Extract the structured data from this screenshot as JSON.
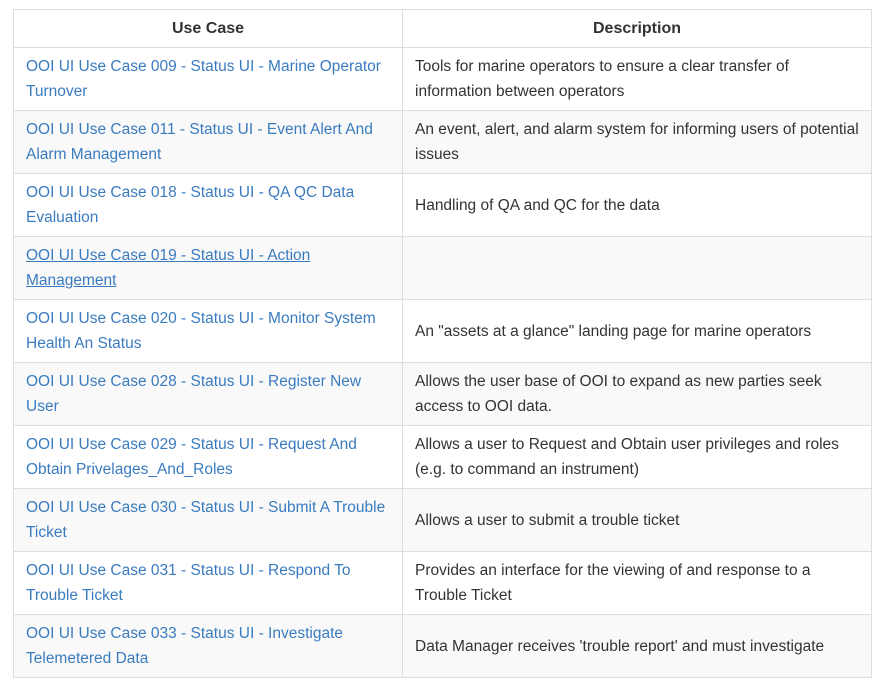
{
  "table": {
    "headers": [
      "Use Case",
      "Description"
    ],
    "link_color": "#3a7bbf",
    "rows": [
      {
        "use_case": "OOI UI Use Case 009 - Status UI - Marine Operator Turnover",
        "description": "Tools for marine operators to ensure a clear transfer of information between operators"
      },
      {
        "use_case": "OOI UI Use Case 011 - Status UI - Event Alert And Alarm Management",
        "description": "An event, alert, and alarm system for informing users of potential issues"
      },
      {
        "use_case": "OOI UI Use Case 018 - Status UI - QA QC Data Evaluation",
        "description": "Handling of QA and QC for the data"
      },
      {
        "use_case": "OOI UI Use Case 019 - Status UI - Action Management",
        "description": ""
      },
      {
        "use_case": "OOI UI Use Case 020 - Status UI - Monitor System Health An Status",
        "description": "An \"assets at a glance\" landing page for marine operators"
      },
      {
        "use_case": "OOI UI Use Case 028 - Status UI - Register New User",
        "description": "Allows the user base of OOI to expand as new parties seek access to OOI data."
      },
      {
        "use_case": "OOI UI Use Case 029 - Status UI - Request And Obtain Privelages_And_Roles",
        "description": "Allows a user to Request and Obtain user privileges and roles (e.g. to command an instrument)"
      },
      {
        "use_case": "OOI UI Use Case 030 - Status UI - Submit A Trouble Ticket",
        "description": "Allows a user to submit a trouble ticket"
      },
      {
        "use_case": "OOI UI Use Case 031 - Status UI - Respond To Trouble Ticket",
        "description": "Provides an interface for the viewing of and response to a Trouble Ticket"
      },
      {
        "use_case": "OOI UI Use Case 033 - Status UI - Investigate Telemetered Data",
        "description": "Data Manager receives 'trouble report' and must investigate"
      }
    ]
  }
}
